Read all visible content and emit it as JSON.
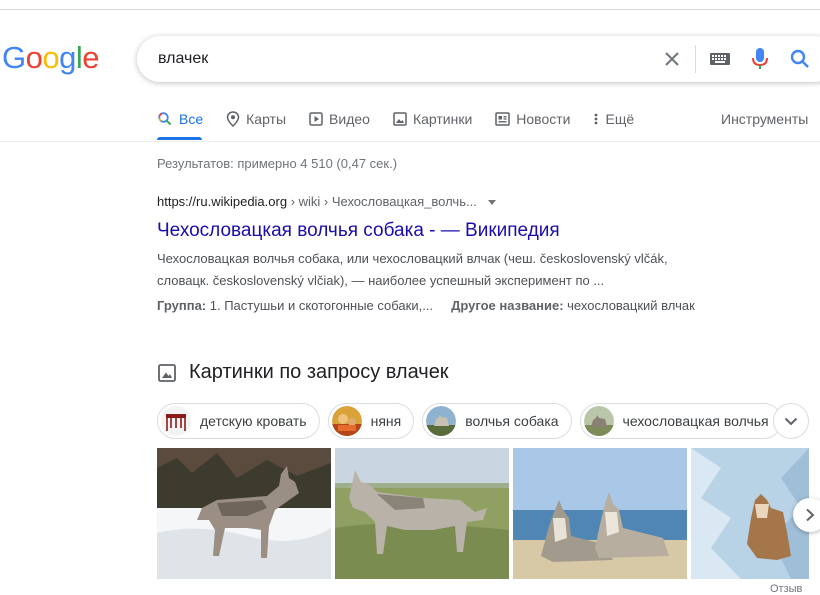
{
  "logo": {
    "letters": [
      "G",
      "o",
      "o",
      "g",
      "l",
      "e"
    ],
    "colors": [
      "#4285f4",
      "#ea4335",
      "#fbbc05",
      "#4285f4",
      "#34a853",
      "#ea4335"
    ]
  },
  "search": {
    "query": "влачек"
  },
  "tabs": [
    {
      "label": "Все",
      "icon": "search-icon",
      "active": true
    },
    {
      "label": "Карты",
      "icon": "map-pin-icon"
    },
    {
      "label": "Видео",
      "icon": "video-icon"
    },
    {
      "label": "Картинки",
      "icon": "image-icon"
    },
    {
      "label": "Новости",
      "icon": "news-icon"
    },
    {
      "label": "Ещё",
      "icon": "more-vert-icon"
    }
  ],
  "tools_label": "Инструменты",
  "stats": "Результатов: примерно 4 510 (0,47 сек.)",
  "result": {
    "cite_domain": "https://ru.wikipedia.org",
    "cite_path": " › wiki › Чехословацкая_волчь...",
    "title": "Чехословацкая волчья собака - — Википедия",
    "snippet": "Чехословацкая волчья собака, или чехословацкий влчак (чеш. československý vlčák, словацк. československý vlčiak), — наиболее успешный эксперимент по ...",
    "attr1_label": "Группа:",
    "attr1_value": " 1. Пастушьи и скотогонные собаки,...",
    "attr2_label": "Другое название:",
    "attr2_value": " чехословацкий влчак"
  },
  "images": {
    "header": "Картинки по запросу влачек",
    "chips": [
      {
        "label": "детскую кровать",
        "thumb": "crib-icon"
      },
      {
        "label": "няня",
        "thumb": "nanny-photo"
      },
      {
        "label": "волчья собака",
        "thumb": "wolfdog-photo"
      },
      {
        "label": "чехословацкая волчья",
        "thumb": "wolfdog-photo"
      }
    ],
    "footer_fragment": "Отзыв"
  },
  "colors": {
    "accent": "#1a73e8",
    "link": "#1a0dab"
  }
}
